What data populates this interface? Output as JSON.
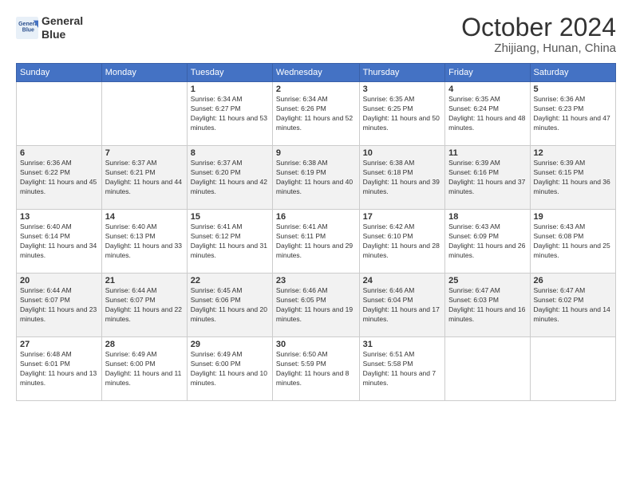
{
  "header": {
    "logo_line1": "General",
    "logo_line2": "Blue",
    "month": "October 2024",
    "location": "Zhijiang, Hunan, China"
  },
  "weekdays": [
    "Sunday",
    "Monday",
    "Tuesday",
    "Wednesday",
    "Thursday",
    "Friday",
    "Saturday"
  ],
  "weeks": [
    [
      {
        "day": "",
        "info": ""
      },
      {
        "day": "",
        "info": ""
      },
      {
        "day": "1",
        "info": "Sunrise: 6:34 AM\nSunset: 6:27 PM\nDaylight: 11 hours and 53 minutes."
      },
      {
        "day": "2",
        "info": "Sunrise: 6:34 AM\nSunset: 6:26 PM\nDaylight: 11 hours and 52 minutes."
      },
      {
        "day": "3",
        "info": "Sunrise: 6:35 AM\nSunset: 6:25 PM\nDaylight: 11 hours and 50 minutes."
      },
      {
        "day": "4",
        "info": "Sunrise: 6:35 AM\nSunset: 6:24 PM\nDaylight: 11 hours and 48 minutes."
      },
      {
        "day": "5",
        "info": "Sunrise: 6:36 AM\nSunset: 6:23 PM\nDaylight: 11 hours and 47 minutes."
      }
    ],
    [
      {
        "day": "6",
        "info": "Sunrise: 6:36 AM\nSunset: 6:22 PM\nDaylight: 11 hours and 45 minutes."
      },
      {
        "day": "7",
        "info": "Sunrise: 6:37 AM\nSunset: 6:21 PM\nDaylight: 11 hours and 44 minutes."
      },
      {
        "day": "8",
        "info": "Sunrise: 6:37 AM\nSunset: 6:20 PM\nDaylight: 11 hours and 42 minutes."
      },
      {
        "day": "9",
        "info": "Sunrise: 6:38 AM\nSunset: 6:19 PM\nDaylight: 11 hours and 40 minutes."
      },
      {
        "day": "10",
        "info": "Sunrise: 6:38 AM\nSunset: 6:18 PM\nDaylight: 11 hours and 39 minutes."
      },
      {
        "day": "11",
        "info": "Sunrise: 6:39 AM\nSunset: 6:16 PM\nDaylight: 11 hours and 37 minutes."
      },
      {
        "day": "12",
        "info": "Sunrise: 6:39 AM\nSunset: 6:15 PM\nDaylight: 11 hours and 36 minutes."
      }
    ],
    [
      {
        "day": "13",
        "info": "Sunrise: 6:40 AM\nSunset: 6:14 PM\nDaylight: 11 hours and 34 minutes."
      },
      {
        "day": "14",
        "info": "Sunrise: 6:40 AM\nSunset: 6:13 PM\nDaylight: 11 hours and 33 minutes."
      },
      {
        "day": "15",
        "info": "Sunrise: 6:41 AM\nSunset: 6:12 PM\nDaylight: 11 hours and 31 minutes."
      },
      {
        "day": "16",
        "info": "Sunrise: 6:41 AM\nSunset: 6:11 PM\nDaylight: 11 hours and 29 minutes."
      },
      {
        "day": "17",
        "info": "Sunrise: 6:42 AM\nSunset: 6:10 PM\nDaylight: 11 hours and 28 minutes."
      },
      {
        "day": "18",
        "info": "Sunrise: 6:43 AM\nSunset: 6:09 PM\nDaylight: 11 hours and 26 minutes."
      },
      {
        "day": "19",
        "info": "Sunrise: 6:43 AM\nSunset: 6:08 PM\nDaylight: 11 hours and 25 minutes."
      }
    ],
    [
      {
        "day": "20",
        "info": "Sunrise: 6:44 AM\nSunset: 6:07 PM\nDaylight: 11 hours and 23 minutes."
      },
      {
        "day": "21",
        "info": "Sunrise: 6:44 AM\nSunset: 6:07 PM\nDaylight: 11 hours and 22 minutes."
      },
      {
        "day": "22",
        "info": "Sunrise: 6:45 AM\nSunset: 6:06 PM\nDaylight: 11 hours and 20 minutes."
      },
      {
        "day": "23",
        "info": "Sunrise: 6:46 AM\nSunset: 6:05 PM\nDaylight: 11 hours and 19 minutes."
      },
      {
        "day": "24",
        "info": "Sunrise: 6:46 AM\nSunset: 6:04 PM\nDaylight: 11 hours and 17 minutes."
      },
      {
        "day": "25",
        "info": "Sunrise: 6:47 AM\nSunset: 6:03 PM\nDaylight: 11 hours and 16 minutes."
      },
      {
        "day": "26",
        "info": "Sunrise: 6:47 AM\nSunset: 6:02 PM\nDaylight: 11 hours and 14 minutes."
      }
    ],
    [
      {
        "day": "27",
        "info": "Sunrise: 6:48 AM\nSunset: 6:01 PM\nDaylight: 11 hours and 13 minutes."
      },
      {
        "day": "28",
        "info": "Sunrise: 6:49 AM\nSunset: 6:00 PM\nDaylight: 11 hours and 11 minutes."
      },
      {
        "day": "29",
        "info": "Sunrise: 6:49 AM\nSunset: 6:00 PM\nDaylight: 11 hours and 10 minutes."
      },
      {
        "day": "30",
        "info": "Sunrise: 6:50 AM\nSunset: 5:59 PM\nDaylight: 11 hours and 8 minutes."
      },
      {
        "day": "31",
        "info": "Sunrise: 6:51 AM\nSunset: 5:58 PM\nDaylight: 11 hours and 7 minutes."
      },
      {
        "day": "",
        "info": ""
      },
      {
        "day": "",
        "info": ""
      }
    ]
  ]
}
